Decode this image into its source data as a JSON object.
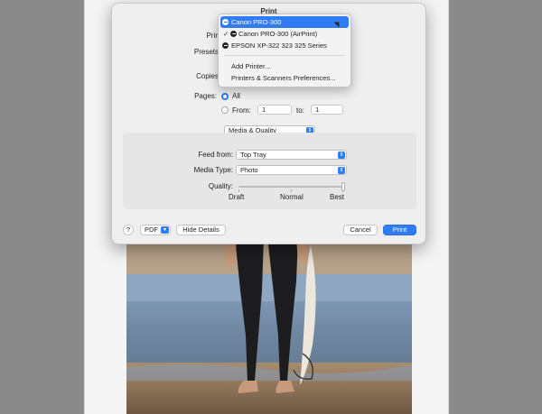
{
  "dialog": {
    "title": "Print",
    "printer_label": "Printer",
    "presets_label": "Presets",
    "copies_label": "Copies",
    "pages_label": "Pages:",
    "pages_all": "All",
    "pages_from": "From:",
    "pages_from_value": "1",
    "pages_to": "to:",
    "pages_to_value": "1",
    "section_popup": "Media & Quality",
    "feed_from_label": "Feed from:",
    "feed_from_value": "Top Tray",
    "media_type_label": "Media Type:",
    "media_type_value": "Photo",
    "quality_label": "Quality:",
    "quality_draft": "Draft",
    "quality_normal": "Normal",
    "quality_best": "Best",
    "quality_level": 1.0,
    "help_label": "?",
    "pdf_label": "PDF",
    "hide_details_label": "Hide Details",
    "cancel_label": "Cancel",
    "print_label": "Print"
  },
  "printer_menu": {
    "items": [
      {
        "label": "Canon PRO-300",
        "selected": true
      },
      {
        "label": "Canon PRO-300 (AirPrint)",
        "checked": true
      },
      {
        "label": "EPSON XP-322 323 325 Series"
      }
    ],
    "add_printer": "Add Printer...",
    "preferences": "Printers & Scanners Preferences..."
  },
  "colors": {
    "accent": "#2f7cf6"
  }
}
